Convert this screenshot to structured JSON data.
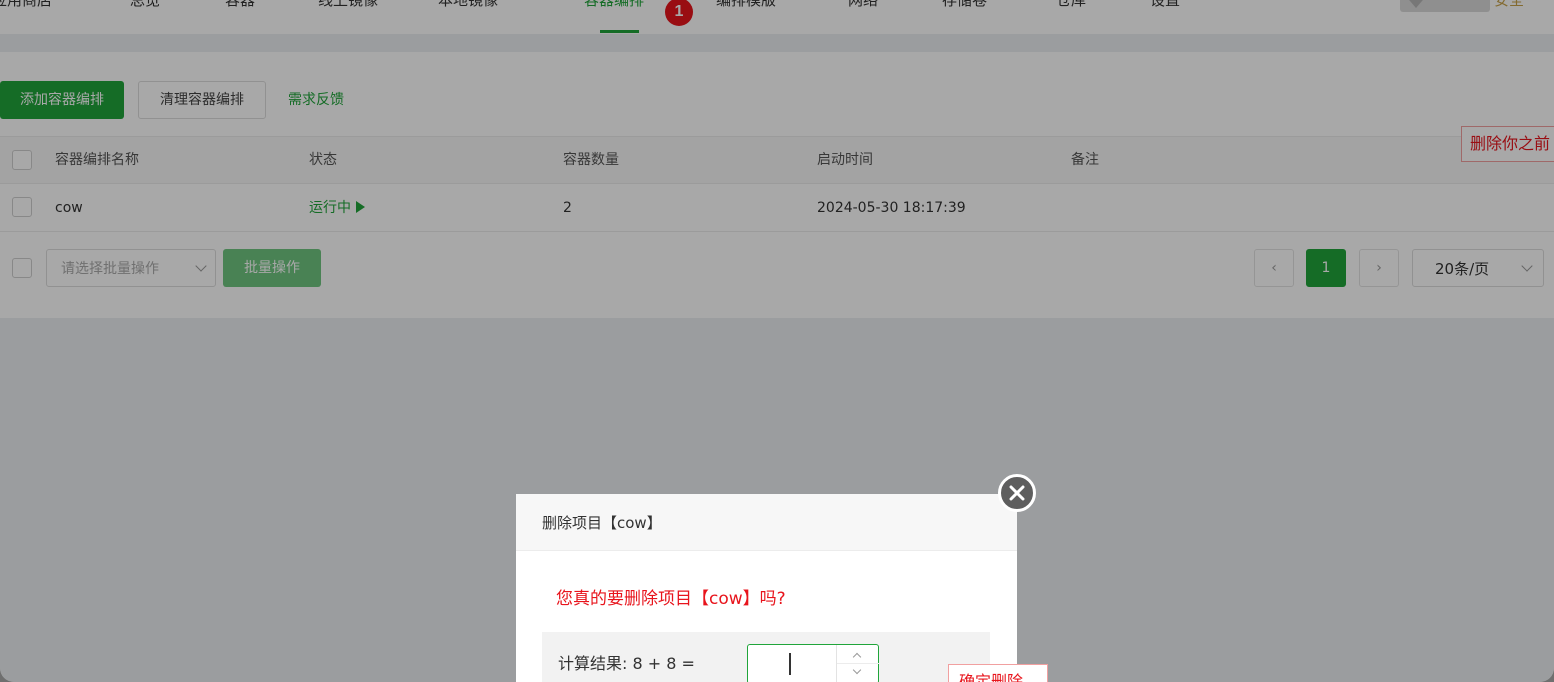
{
  "nav": {
    "items": [
      {
        "label": "应用商店"
      },
      {
        "label": "总览"
      },
      {
        "label": "容器"
      },
      {
        "label": "线上镜像"
      },
      {
        "label": "本地镜像"
      },
      {
        "label": "容器编排"
      },
      {
        "label": "编排模版"
      },
      {
        "label": "网络"
      },
      {
        "label": "存储卷"
      },
      {
        "label": "仓库"
      },
      {
        "label": "设置"
      }
    ],
    "active_index": 5,
    "badge": "1",
    "right_text": "安全"
  },
  "toolbar": {
    "add_label": "添加容器编排",
    "clean_label": "清理容器编排",
    "feedback_label": "需求反馈"
  },
  "table": {
    "columns": [
      "容器编排名称",
      "状态",
      "容器数量",
      "启动时间",
      "备注"
    ],
    "rows": [
      {
        "name": "cow",
        "status": "运行中",
        "count": "2",
        "started": "2024-05-30 18:17:39",
        "note": ""
      }
    ]
  },
  "bulk": {
    "placeholder": "请选择批量操作",
    "button_label": "批量操作"
  },
  "pager": {
    "prev": "‹",
    "current": "1",
    "next": "›",
    "page_size": "20条/页"
  },
  "hints": {
    "right": "删除你之前",
    "confirm": "确定删除"
  },
  "dialog": {
    "title": "删除项目【cow】",
    "question": "您真的要删除项目【cow】吗?",
    "calc_label": "计算结果:   8 + 8  =",
    "input_value": ""
  },
  "colors": {
    "primary": "#20a53a",
    "danger": "#e8141c",
    "overlay": "rgba(0,0,0,0.34)"
  }
}
